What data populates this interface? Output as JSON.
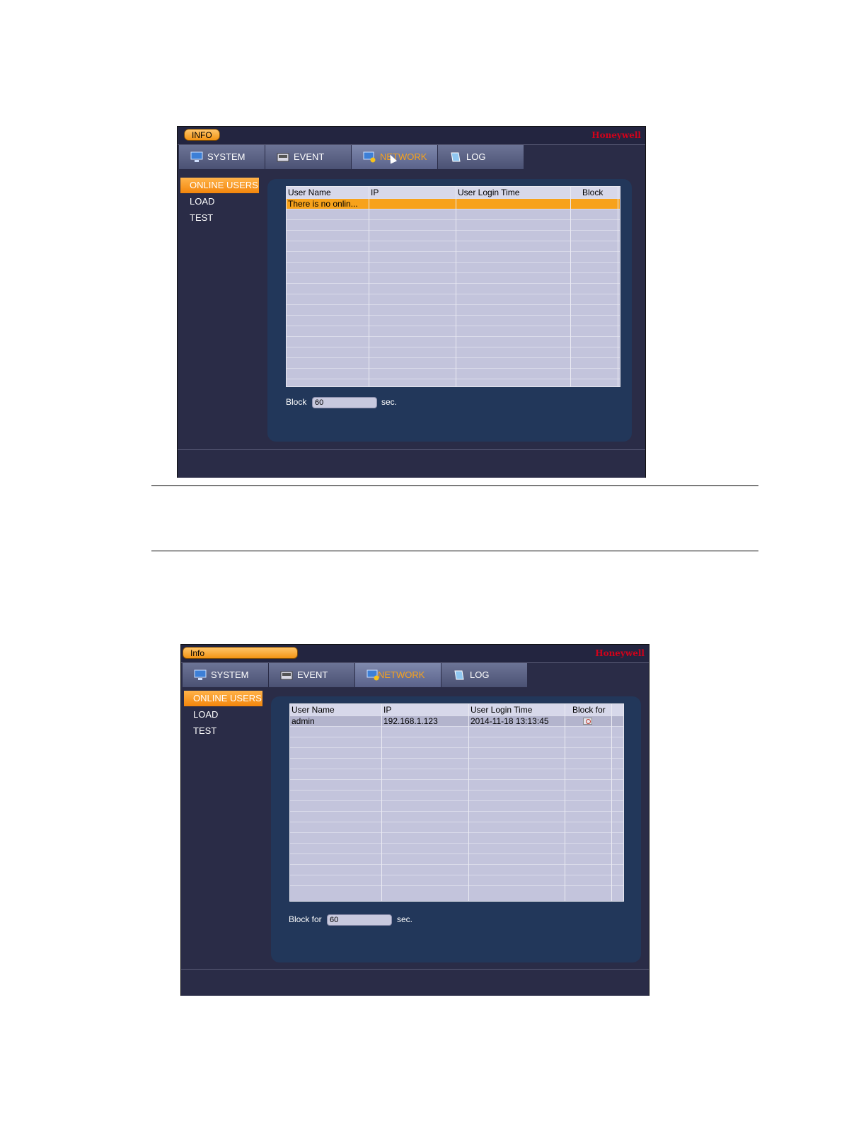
{
  "screen1": {
    "header": {
      "title": "INFO",
      "brand": "Honeywell"
    },
    "tabs": [
      {
        "label": "SYSTEM"
      },
      {
        "label": "EVENT"
      },
      {
        "label": "NETWORK"
      },
      {
        "label": "LOG"
      }
    ],
    "sidebar": [
      {
        "label": "ONLINE USERS"
      },
      {
        "label": "LOAD"
      },
      {
        "label": "TEST"
      }
    ],
    "table": {
      "columns": [
        "User Name",
        "IP",
        "User Login Time",
        "Block"
      ],
      "rows": [
        [
          "There is no onlin...",
          "",
          "",
          ""
        ]
      ]
    },
    "block": {
      "label": "Block",
      "value": "60",
      "unit": "sec."
    }
  },
  "screen2": {
    "header": {
      "title": "Info",
      "brand": "Honeywell"
    },
    "tabs": [
      {
        "label": "SYSTEM"
      },
      {
        "label": "EVENT"
      },
      {
        "label": "NETWORK"
      },
      {
        "label": "LOG"
      }
    ],
    "sidebar": [
      {
        "label": "ONLINE USERS"
      },
      {
        "label": "LOAD"
      },
      {
        "label": "TEST"
      }
    ],
    "table": {
      "columns": [
        "User Name",
        "IP",
        "User Login Time",
        "Block for"
      ],
      "rows": [
        [
          "admin",
          "192.168.1.123",
          "2014-11-18 13:13:45",
          ""
        ]
      ]
    },
    "block": {
      "label": "Block for",
      "value": "60",
      "unit": "sec."
    }
  }
}
